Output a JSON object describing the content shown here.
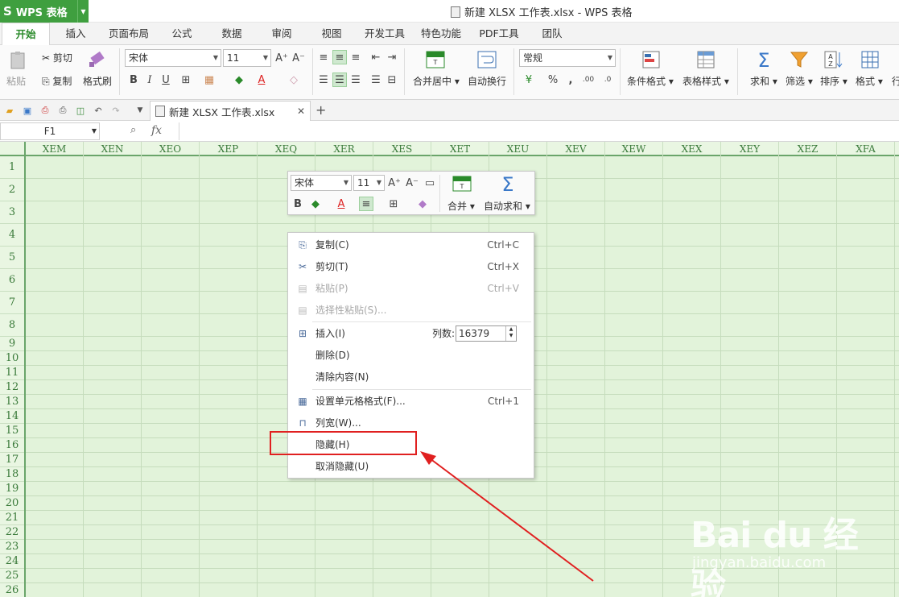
{
  "app": {
    "name": "WPS 表格",
    "logo": "S",
    "window_title": "新建 XLSX 工作表.xlsx - WPS 表格"
  },
  "menu_tabs": [
    "开始",
    "插入",
    "页面布局",
    "公式",
    "数据",
    "审阅",
    "视图",
    "开发工具",
    "特色功能",
    "PDF工具",
    "团队"
  ],
  "ribbon": {
    "paste": "粘贴",
    "cut": "剪切",
    "copy": "复制",
    "format_painter": "格式刷",
    "font_name": "宋体",
    "font_size": "11",
    "merge_center": "合并居中",
    "wrap_text": "自动换行",
    "number_format": "常规",
    "cond_format": "条件格式",
    "table_style": "表格样式",
    "sum": "求和",
    "filter": "筛选",
    "sort": "排序",
    "format": "格式",
    "row_col": "行"
  },
  "quick_bar": {
    "doc_tab": "新建 XLSX 工作表.xlsx"
  },
  "formula_bar": {
    "cell_ref": "F1",
    "fx": "fx"
  },
  "columns": [
    "XEM",
    "XEN",
    "XEO",
    "XEP",
    "XEQ",
    "XER",
    "XES",
    "XET",
    "XEU",
    "XEV",
    "XEW",
    "XEX",
    "XEY",
    "XEZ",
    "XFA"
  ],
  "rows": [
    "1",
    "2",
    "3",
    "4",
    "5",
    "6",
    "7",
    "8",
    "9",
    "10",
    "11",
    "12",
    "13",
    "14",
    "15",
    "16",
    "17",
    "18",
    "19",
    "20",
    "21",
    "22",
    "23",
    "24",
    "25",
    "26"
  ],
  "mini_toolbar": {
    "font_name": "宋体",
    "font_size": "11",
    "merge": "合并",
    "autosum": "自动求和"
  },
  "context_menu": {
    "copy": {
      "label": "复制(C)",
      "key": "Ctrl+C"
    },
    "cut": {
      "label": "剪切(T)",
      "key": "Ctrl+X"
    },
    "paste": {
      "label": "粘贴(P)",
      "key": "Ctrl+V"
    },
    "paste_special": {
      "label": "选择性粘贴(S)..."
    },
    "insert": {
      "label": "插入(I)",
      "count_label": "列数:",
      "count_value": "16379"
    },
    "delete": {
      "label": "删除(D)"
    },
    "clear": {
      "label": "清除内容(N)"
    },
    "format_cells": {
      "label": "设置单元格格式(F)...",
      "key": "Ctrl+1"
    },
    "col_width": {
      "label": "列宽(W)..."
    },
    "hide": {
      "label": "隐藏(H)"
    },
    "unhide": {
      "label": "取消隐藏(U)"
    }
  },
  "watermark": {
    "brand": "Bai du 经验",
    "url": "jingyan.baidu.com"
  },
  "colors": {
    "accent_green": "#3f9f3f",
    "grid_bg": "#e2f3da",
    "highlight_red": "#e02020"
  }
}
